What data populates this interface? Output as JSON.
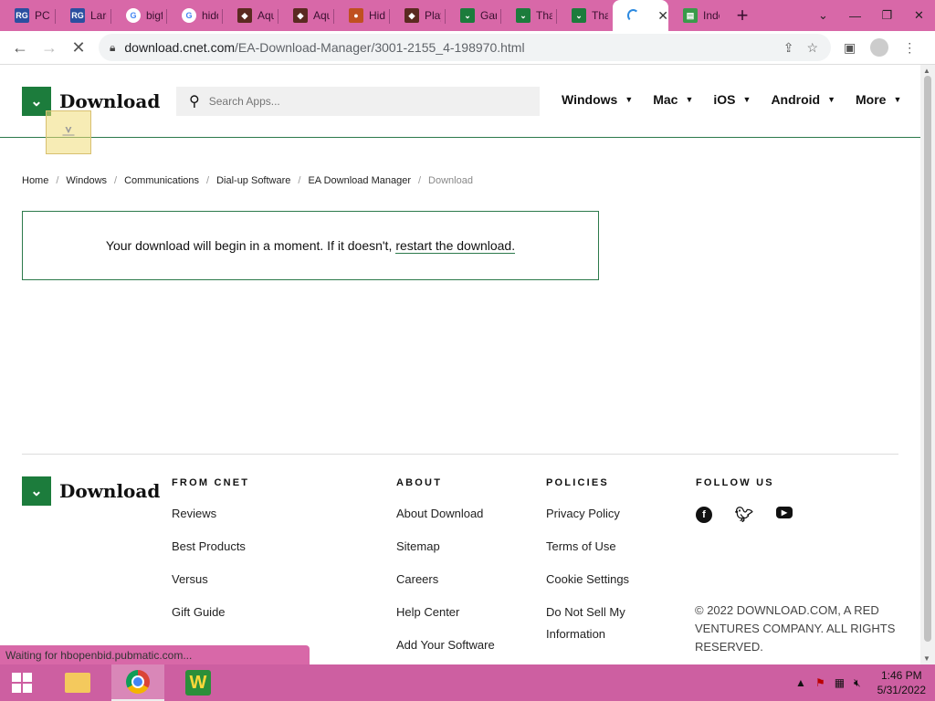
{
  "browser": {
    "tabs": [
      {
        "title": "PC",
        "favicon": "rg-icon",
        "color": "#2b4fa0"
      },
      {
        "title": "Larg",
        "favicon": "rg-icon",
        "color": "#2b4fa0"
      },
      {
        "title": "bigfi",
        "favicon": "google-icon",
        "color": "#ffffff"
      },
      {
        "title": "hidd",
        "favicon": "google-icon",
        "color": "#ffffff"
      },
      {
        "title": "Aqu",
        "favicon": "game-icon",
        "color": "#5a2a20"
      },
      {
        "title": "Aqu",
        "favicon": "game-icon",
        "color": "#5a2a20"
      },
      {
        "title": "Hid",
        "favicon": "game-icon",
        "color": "#c05020"
      },
      {
        "title": "Play",
        "favicon": "game-icon",
        "color": "#5a2a20"
      },
      {
        "title": "Gan",
        "favicon": "download-icon",
        "color": "#1c7c3c"
      },
      {
        "title": "Tha",
        "favicon": "download-icon",
        "color": "#1c7c3c"
      },
      {
        "title": "Tha",
        "favicon": "download-icon",
        "color": "#1c7c3c"
      },
      {
        "title": "",
        "favicon": "loading-spinner",
        "active": true
      },
      {
        "title": "Inde",
        "favicon": "image-icon",
        "color": "#3a9a4a"
      }
    ],
    "url_host": "download.cnet.com",
    "url_path": "/EA-Download-Manager/3001-2155_4-198970.html",
    "status_text": "Waiting for hbopenbid.pubmatic.com..."
  },
  "site": {
    "logo_text": "Download",
    "search_placeholder": "Search Apps...",
    "nav": [
      "Windows",
      "Mac",
      "iOS",
      "Android",
      "More"
    ],
    "breadcrumb": [
      "Home",
      "Windows",
      "Communications",
      "Dial-up Software",
      "EA Download Manager",
      "Download"
    ],
    "notice_text": "Your download will begin in a moment. If it doesn't,",
    "notice_link": "restart the download."
  },
  "footer": {
    "logo_text": "Download",
    "from_cnet": {
      "heading": "FROM CNET",
      "links": [
        "Reviews",
        "Best Products",
        "Versus",
        "Gift Guide"
      ]
    },
    "about": {
      "heading": "ABOUT",
      "links": [
        "About Download",
        "Sitemap",
        "Careers",
        "Help Center",
        "Add Your Software"
      ]
    },
    "policies": {
      "heading": "POLICIES",
      "links": [
        "Privacy Policy",
        "Terms of Use",
        "Cookie Settings",
        "Do Not Sell My Information"
      ]
    },
    "follow": {
      "heading": "FOLLOW US",
      "icons": [
        "facebook-icon",
        "twitter-icon",
        "youtube-icon"
      ]
    },
    "copyright": "© 2022 DOWNLOAD.COM, A RED VENTURES COMPANY. ALL RIGHTS RESERVED."
  },
  "taskbar": {
    "time": "1:46 PM",
    "date": "5/31/2022",
    "apps": [
      "file-explorer-icon",
      "chrome-icon",
      "wordweb-icon"
    ]
  },
  "colors": {
    "brand_green": "#1c7c3c",
    "chrome_accent": "#d868a8",
    "taskbar": "#cd5fa1"
  }
}
